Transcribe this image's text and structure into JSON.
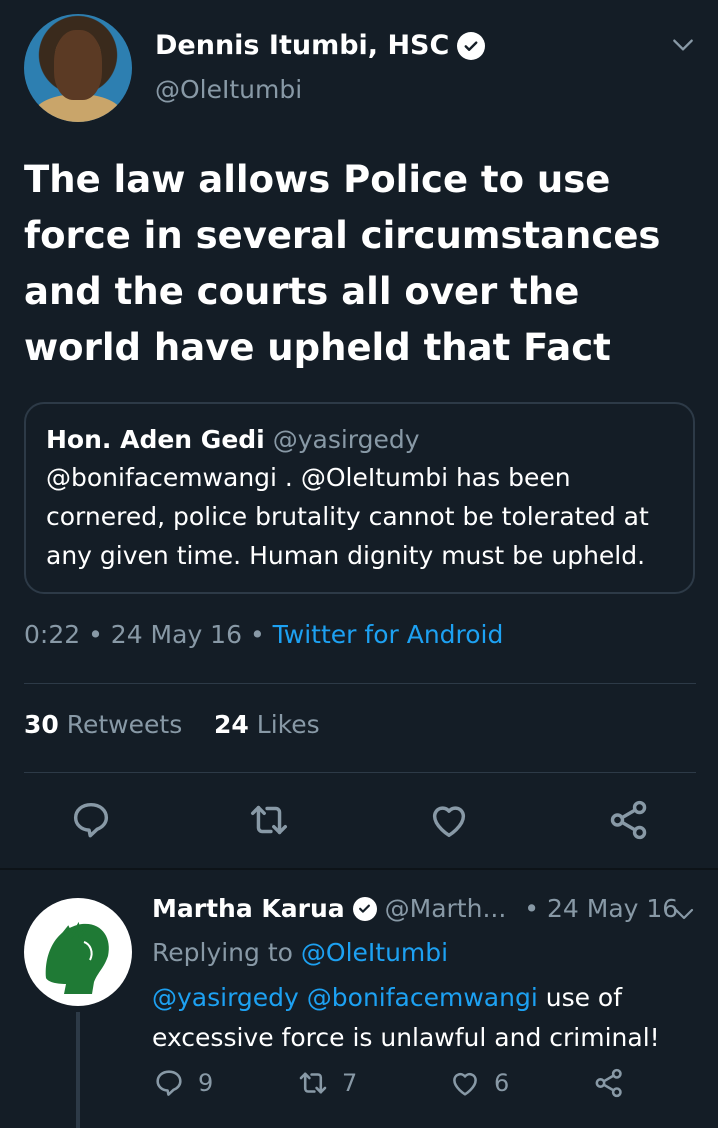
{
  "main_tweet": {
    "author_name": "Dennis Itumbi, HSC",
    "handle": "@OleItumbi",
    "text": "The law allows Police to use force in several circumstances and the courts all over the world have upheld that Fact",
    "quote": {
      "author_name": "Hon. Aden Gedi",
      "handle": "@yasirgedy",
      "text": "@bonifacemwangi . @OleItumbi has been cornered, police brutality cannot be tolerated at any given time. Human dignity must be upheld."
    },
    "time": "0:22",
    "separator": "•",
    "date": "24 May 16",
    "source": "Twitter for Android",
    "retweets_count": "30",
    "retweets_label": "Retweets",
    "likes_count": "24",
    "likes_label": "Likes"
  },
  "reply_tweet": {
    "author_name": "Martha Karua",
    "handle": "@Marth...",
    "date_label": "• 24 May 16",
    "replying_prefix": "Replying to",
    "replying_to": "@OleItumbi",
    "mentions": "@yasirgedy @bonifacemwangi",
    "text": "use of excessive force is unlawful and criminal!",
    "reply_count": "9",
    "retweet_count": "7",
    "like_count": "6"
  },
  "colors": {
    "background": "#141d26",
    "text": "#ffffff",
    "muted": "#8899a6",
    "link": "#1da1f2",
    "border": "#2d3a47"
  },
  "icons": [
    "verified-icon",
    "chevron-down-icon",
    "reply-icon",
    "retweet-icon",
    "like-icon",
    "share-icon"
  ]
}
